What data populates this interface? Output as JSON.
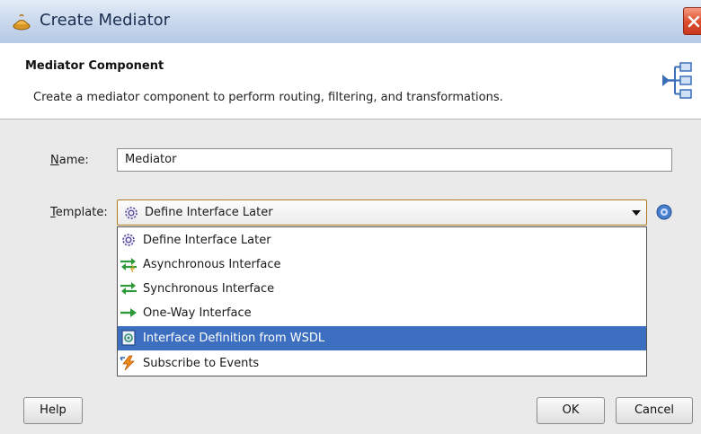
{
  "window": {
    "title": "Create Mediator"
  },
  "header": {
    "title": "Mediator Component",
    "description": "Create a mediator component to perform routing, filtering, and transformations."
  },
  "form": {
    "name_label_mnemonic": "N",
    "name_label_rest": "ame:",
    "name_value": "Mediator",
    "template_label_mnemonic": "T",
    "template_label_rest": "emplate:",
    "template_selected": "Define Interface Later"
  },
  "dropdown": {
    "items": [
      {
        "label": "Define Interface Later",
        "icon": "gear-icon"
      },
      {
        "label": "Asynchronous Interface",
        "icon": "async-interface-icon"
      },
      {
        "label": "Synchronous Interface",
        "icon": "sync-interface-icon"
      },
      {
        "label": "One-Way Interface",
        "icon": "one-way-arrow-icon"
      },
      {
        "label": "Interface Definition from WSDL",
        "icon": "wsdl-icon"
      },
      {
        "label": "Subscribe to Events",
        "icon": "event-lightning-icon"
      }
    ],
    "selected_index": 4
  },
  "buttons": {
    "help": "Help",
    "ok": "OK",
    "cancel": "Cancel"
  },
  "colors": {
    "selection": "#3d6fc1",
    "titlebar": "#c7d7ec",
    "close": "#dc4b2c"
  }
}
